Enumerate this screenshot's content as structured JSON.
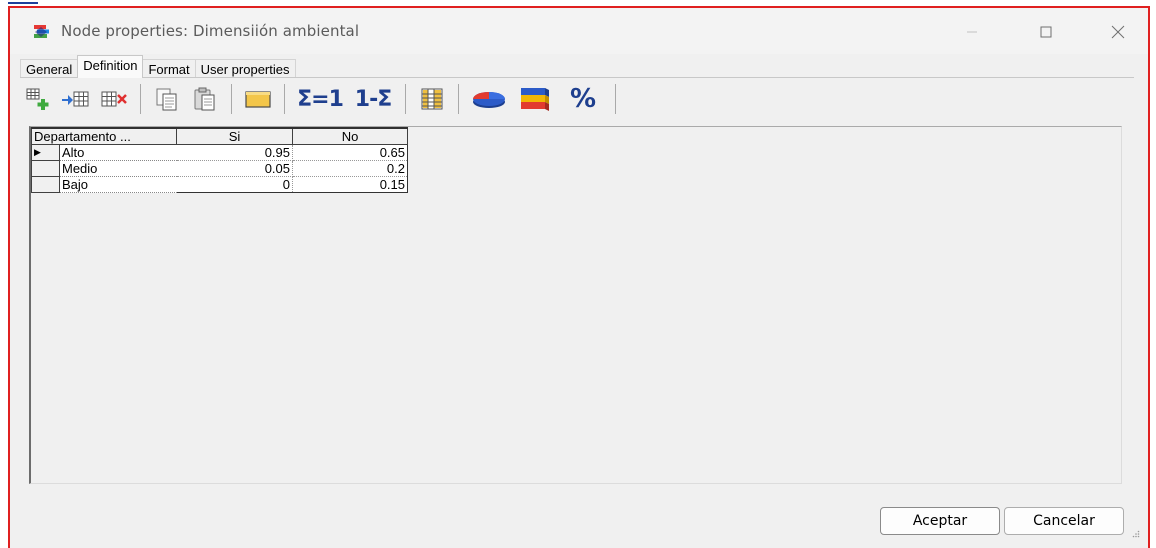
{
  "window": {
    "title": "Node properties: Dimensiión ambiental"
  },
  "tabs": [
    {
      "label": "General"
    },
    {
      "label": "Definition"
    },
    {
      "label": "Format"
    },
    {
      "label": "User properties"
    }
  ],
  "active_tab": "Definition",
  "toolbar": {
    "items": [
      {
        "icon": "add-column-icon"
      },
      {
        "icon": "insert-column-icon"
      },
      {
        "icon": "delete-column-icon"
      },
      {
        "icon": "copy-icon"
      },
      {
        "icon": "paste-icon"
      },
      {
        "icon": "note-icon"
      },
      {
        "icon": "normalize-icon",
        "label": "Σ=1"
      },
      {
        "icon": "complement-icon",
        "label": "1-Σ"
      },
      {
        "icon": "fill-table-icon"
      },
      {
        "icon": "pie-chart-icon"
      },
      {
        "icon": "stacked-bar-icon"
      },
      {
        "icon": "percent-icon",
        "label": "%"
      }
    ]
  },
  "grid": {
    "columns": [
      "Departamento ...",
      "Si",
      "No"
    ],
    "rows": [
      {
        "label": "Alto",
        "si": "0.95",
        "no": "0.65"
      },
      {
        "label": "Medio",
        "si": "0.05",
        "no": "0.2"
      },
      {
        "label": "Bajo",
        "si": "0",
        "no": "0.15"
      }
    ]
  },
  "buttons": {
    "ok_label": "Aceptar",
    "cancel_label": "Cancelar"
  },
  "colors": {
    "frame_border": "#e02020",
    "sigma_blue": "#1f3f8e"
  }
}
